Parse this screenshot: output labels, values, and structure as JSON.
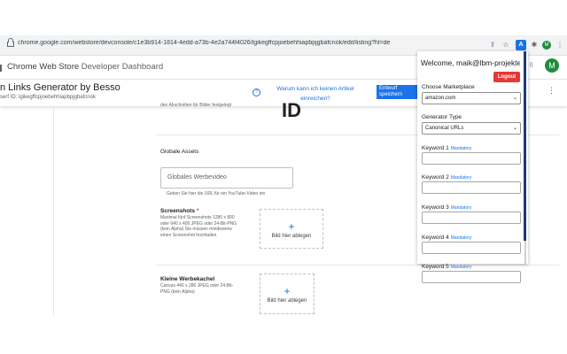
{
  "browser": {
    "url": "chrome.google.com/webstore/devconsole/c1e3b914-1814-4edd-a73b-4e2a744f4026/lgikegffcpjoebehhiapbpjgbafcnok/edit/listing?hl=de",
    "toolbar_icons": [
      "share-icon",
      "star-icon",
      "extension-a-icon",
      "puzzle-icon",
      "profile-avatar",
      "kebab-menu-icon"
    ],
    "ext_badge": "A",
    "avatar_letter": "M"
  },
  "store_header": {
    "brand": "Chrome Web Store",
    "section": "Developer Dashboard",
    "avatar_letter": "M"
  },
  "item_header": {
    "title": "n Links Generator by Besso",
    "id_line": "serf    ID: lgikegffcpjoebehhiapbpjgbafcnok",
    "help_link": "Warum kann ich keinen Artikel einreichen?",
    "primary_button": "Entwurf speichern"
  },
  "content": {
    "cut_text": "den Abschnitten für Bilder festgelegt",
    "big_glyph": "ID",
    "global_assets": "Globale Assets",
    "video_placeholder": "Globales Werbevideo",
    "video_helper": "Geben Sie hier die URL für ein YouTube-Video ein",
    "screenshots": {
      "label": "Screenshots",
      "required_mark": "*",
      "spec": "Maximal fünf Screenshots 1280 x 800 oder 640 x 400 JPEG oder 24-Bit-PNG (kein Alpha) Sie müssen mindestens einen Screenshot hochladen",
      "drop_label": "Bild hier ablegen"
    },
    "small_tile": {
      "label": "Kleine Werbekachel",
      "spec": "Canvas 440 x 280 JPEG oder 24-Bit-PNG (kein Alpha)",
      "drop_label": "Bild hier ablegen"
    },
    "plus": "+"
  },
  "popup": {
    "welcome": "Welcome, maik@lbm-projekte.de",
    "logout": "Logout",
    "marketplace_label": "Choose Marketplace",
    "marketplace_value": "amazon.com",
    "generator_label": "Generator Type",
    "generator_value": "Canonical URLs",
    "mandatory": "Mandatory",
    "keywords": [
      "Keyword 1",
      "Keyword 2",
      "Keyword 3",
      "Keyword 4",
      "Keyword 5"
    ],
    "chevron": "⌄"
  },
  "colors": {
    "accent": "#1a73e8",
    "logout": "#e53935",
    "popup_bar": "#1c3b72",
    "avatar": "#1e8e3e"
  }
}
